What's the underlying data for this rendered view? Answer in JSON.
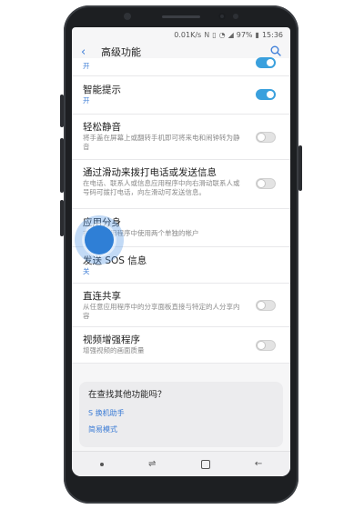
{
  "statusbar": {
    "speed": "0.01K/s",
    "battery": "97%",
    "time": "15:36"
  },
  "header": {
    "title": "高级功能"
  },
  "items": [
    {
      "title": "",
      "subtitle": "开",
      "toggle": "on",
      "subtitle_color": "blue"
    },
    {
      "title": "智能提示",
      "subtitle": "开",
      "toggle": "on",
      "subtitle_color": "blue"
    },
    {
      "title": "轻松静音",
      "subtitle": "将手盖在屏幕上或翻转手机即可将来电和闹钟转为静音",
      "toggle": "off",
      "subtitle_color": "gray"
    },
    {
      "title": "通过滑动来拨打电话或发送信息",
      "subtitle": "在电话、联系人或信息应用程序中向右滑动联系人或号码可拨打电话，向左滑动可发送信息。",
      "toggle": "off",
      "subtitle_color": "gray"
    },
    {
      "title": "应用分身",
      "subtitle": "在一个应用程序中使用两个单独的帐户",
      "toggle": "none",
      "subtitle_color": "gray"
    },
    {
      "title": "发送 SOS 信息",
      "subtitle": "关",
      "toggle": "none",
      "subtitle_color": "blue"
    },
    {
      "title": "直连共享",
      "subtitle": "从任意应用程序中的分享面板直接与特定的人分享内容",
      "toggle": "off",
      "subtitle_color": "gray"
    },
    {
      "title": "视频增强程序",
      "subtitle": "增强视频的画面质量",
      "toggle": "off",
      "subtitle_color": "gray"
    }
  ],
  "suggestion_card": {
    "title": "在查找其他功能吗？",
    "links": [
      "S 换机助手",
      "简易模式"
    ]
  },
  "colors": {
    "accent": "#3a7bd5",
    "toggle_on": "#3aa0dd",
    "tap_indicator": "#2f7fd6"
  }
}
